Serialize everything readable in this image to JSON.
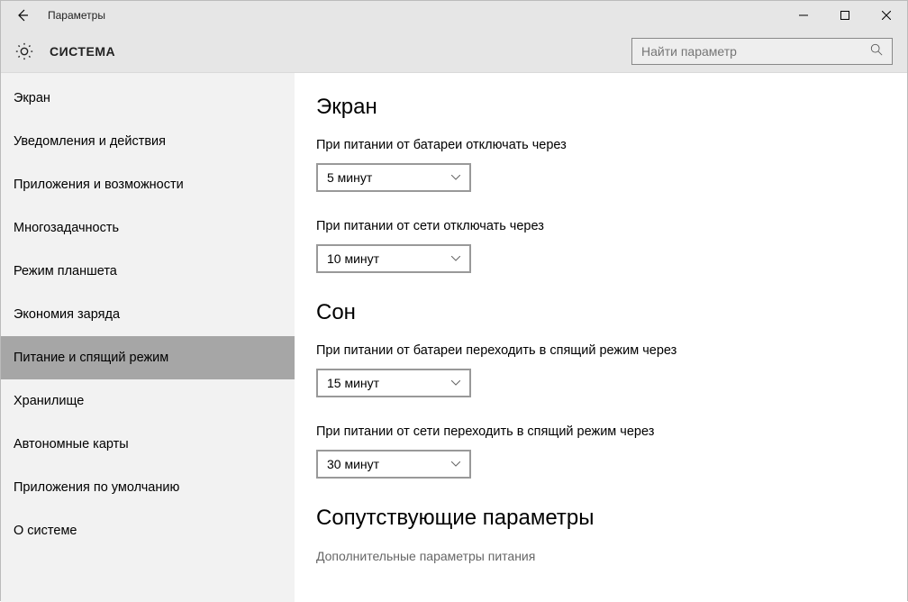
{
  "titlebar": {
    "title": "Параметры"
  },
  "header": {
    "section": "СИСТЕМА",
    "search_placeholder": "Найти параметр"
  },
  "sidebar": {
    "items": [
      {
        "label": "Экран"
      },
      {
        "label": "Уведомления и действия"
      },
      {
        "label": "Приложения и возможности"
      },
      {
        "label": "Многозадачность"
      },
      {
        "label": "Режим планшета"
      },
      {
        "label": "Экономия заряда"
      },
      {
        "label": "Питание и спящий режим",
        "selected": true
      },
      {
        "label": "Хранилище"
      },
      {
        "label": "Автономные карты"
      },
      {
        "label": "Приложения по умолчанию"
      },
      {
        "label": "О системе"
      }
    ]
  },
  "main": {
    "screen": {
      "heading": "Экран",
      "battery_label": "При питании от батареи отключать через",
      "battery_value": "5 минут",
      "plugged_label": "При питании от сети отключать через",
      "plugged_value": "10 минут"
    },
    "sleep": {
      "heading": "Сон",
      "battery_label": "При питании от батареи переходить в спящий режим через",
      "battery_value": "15 минут",
      "plugged_label": "При питании от сети переходить в спящий режим через",
      "plugged_value": "30 минут"
    },
    "related": {
      "heading": "Сопутствующие параметры",
      "link": "Дополнительные параметры питания"
    }
  }
}
